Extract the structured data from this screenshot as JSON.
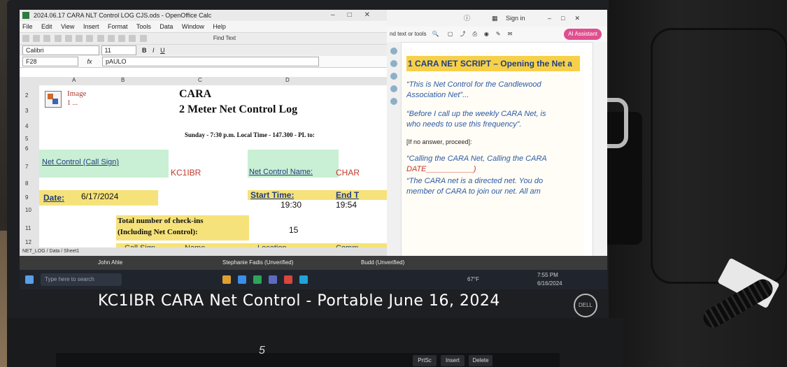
{
  "caption": "KC1IBR   CARA Net Control - Portable   June 16, 2024",
  "calc": {
    "title": "2024.06.17 CARA NLT Control LOG CJS.ods - OpenOffice Calc",
    "menu": [
      "File",
      "Edit",
      "View",
      "Insert",
      "Format",
      "Tools",
      "Data",
      "Window",
      "Help"
    ],
    "find_text": "Find Text",
    "font_name": "Calibri",
    "font_size": "11",
    "font_style_buttons": [
      "B",
      "I",
      "U"
    ],
    "cell_ref": "F28",
    "fx_label": "fx",
    "formula_value": "pAULO",
    "col_headers": [
      "A",
      "B",
      "C",
      "D"
    ],
    "row_numbers": [
      "2",
      "3",
      "4",
      "5",
      "6",
      "7",
      "8",
      "9",
      "10",
      "11",
      "12",
      "13"
    ],
    "image_label": "Image",
    "image_sub": "1 ...",
    "heading_cara": "CARA",
    "heading_log": "2 Meter Net Control Log",
    "schedule": "Sunday - 7:30 p.m. Local Time - 147.300 - PL to:",
    "net_control_call_label": "Net Control (Call Sign)",
    "net_control_call_value": "KC1IBR",
    "net_control_name_label": "Net Control Name:",
    "net_control_name_value": "CHAR",
    "date_label": "Date:",
    "date_value": "6/17/2024",
    "start_time_label": "Start Time:",
    "start_time_value": "19:30",
    "end_time_label": "End T",
    "end_time_value": "19:54",
    "checkins_label_1": "Total number of check-ins",
    "checkins_label_2": "(Including Net Control):",
    "checkins_value": "15",
    "table_headers": [
      "Call Sign",
      "Name",
      "Location",
      "Comm"
    ],
    "sheet_tabs": "NET_LOG / Data / Sheet1"
  },
  "reader": {
    "sign_in": "Sign in",
    "search_placeholder": "nd text or tools",
    "ai_button": "AI Assistant",
    "script_title": "1 CARA NET SCRIPT – Opening the Net a",
    "line1a": "“This is Net Control for the Candlewood",
    "line1b": "Association Net”...",
    "line2a": "“Before I call up the weekly CARA Net, is",
    "line2b": "who needs to use this frequency”.",
    "note": "[If no answer, proceed]:",
    "line3a": "“Calling the CARA Net, Calling the CARA",
    "line3b": "DATE___________)",
    "line4a": "“The CARA net is a directed net. You do",
    "line4b": "member of CARA to join our net. All am"
  },
  "taskbar": {
    "search_placeholder": "Type here to search",
    "video_names": [
      "John Ahle",
      "Stephanie Fadis (Unverified)",
      "Budd (Unverified)"
    ],
    "weather": "67°F",
    "clock_time": "7:55 PM",
    "clock_date": "6/16/2024"
  },
  "laptop": {
    "page_marker": "5",
    "brand": "DELL",
    "keys": [
      "PrtSc",
      "Insert",
      "Delete"
    ]
  }
}
